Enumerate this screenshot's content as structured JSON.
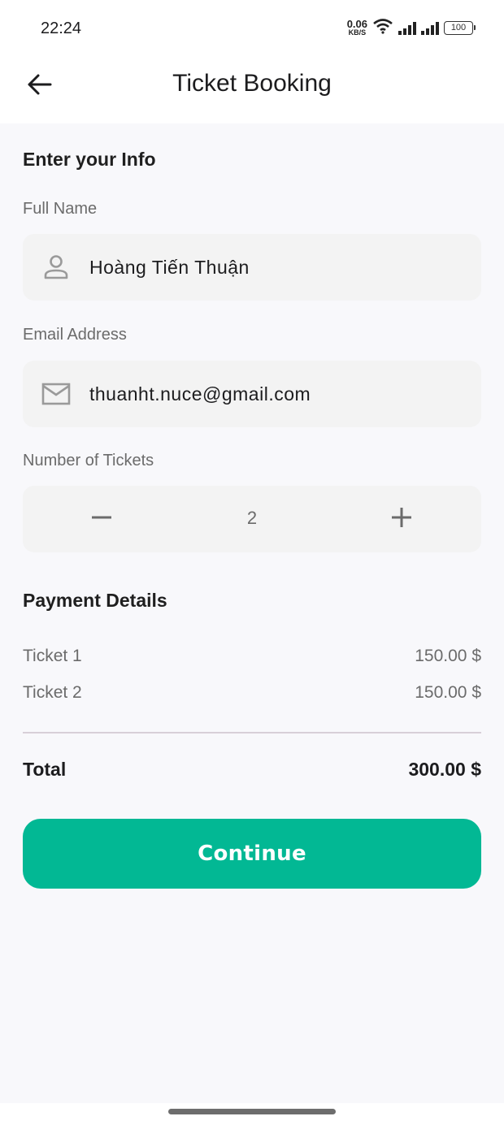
{
  "status_bar": {
    "time": "22:24",
    "net_speed_value": "0.06",
    "net_speed_unit": "KB/S",
    "battery": "100",
    "icons": [
      "wifi-icon",
      "signal-icon",
      "signal-icon",
      "battery-icon"
    ]
  },
  "app_bar": {
    "back_icon": "arrow-left-icon",
    "title": "Ticket Booking"
  },
  "form": {
    "section_title": "Enter your Info",
    "full_name": {
      "label": "Full Name",
      "value": "Hoàng Tiến Thuận",
      "icon": "person-icon"
    },
    "email": {
      "label": "Email Address",
      "value": "thuanht.nuce@gmail.com",
      "icon": "mail-icon"
    },
    "tickets": {
      "label": "Number of Tickets",
      "value": "2",
      "decrement_icon": "minus-icon",
      "increment_icon": "plus-icon"
    }
  },
  "payment": {
    "section_title": "Payment Details",
    "items": [
      {
        "label": "Ticket 1",
        "amount": "150.00 $"
      },
      {
        "label": "Ticket 2",
        "amount": "150.00 $"
      }
    ],
    "total_label": "Total",
    "total_amount": "300.00 $"
  },
  "actions": {
    "continue_label": "Continue"
  },
  "colors": {
    "primary": "#02b894",
    "background": "#f8f8fb",
    "field": "#f3f3f3"
  }
}
